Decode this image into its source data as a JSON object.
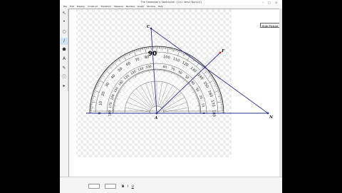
{
  "window": {
    "title": "The Geometer's Sketchpad - [Ch1 Vers1 Num10]"
  },
  "menu": [
    "File",
    "Edit",
    "Display",
    "Construct",
    "Transform",
    "Measure",
    "Number",
    "Graph",
    "Window",
    "Help"
  ],
  "canvas_button": {
    "label": "Hide Picture"
  },
  "points": {
    "A": "A",
    "C": "C",
    "F": "F",
    "N": "N"
  },
  "protractor": {
    "outer_labels": [
      "0",
      "10",
      "20",
      "30",
      "40",
      "50",
      "60",
      "70",
      "80",
      "90",
      "100",
      "110",
      "120",
      "130",
      "140",
      "150",
      "160",
      "170",
      "180"
    ],
    "inner_labels": [
      "180",
      "170",
      "160",
      "150",
      "140",
      "130",
      "120",
      "110",
      "100",
      "90",
      "80",
      "70",
      "60",
      "50",
      "40",
      "30",
      "20",
      "10",
      "0"
    ],
    "center_label": "90"
  },
  "text_toolbar": {
    "bold": "B",
    "italic": "I",
    "underline": "U"
  },
  "colors": {
    "line": "#2e3192",
    "checker": "#ececec"
  }
}
